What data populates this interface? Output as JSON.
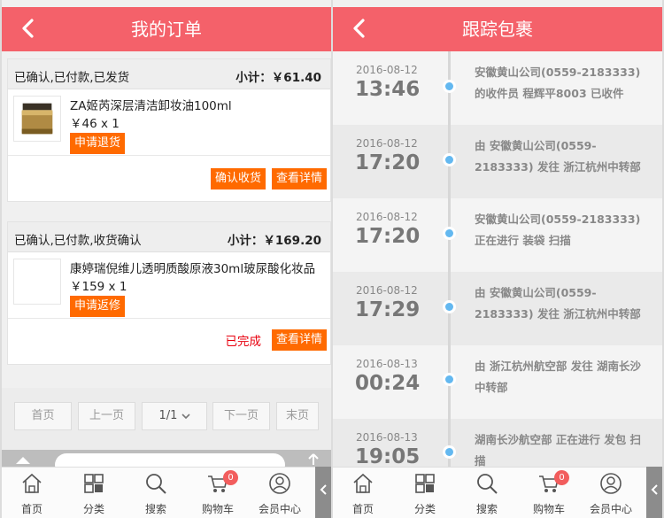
{
  "left": {
    "header": {
      "title": "我的订单"
    },
    "orders": [
      {
        "status": "已确认,已付款,已发货",
        "subtotal": "小计：￥61.40",
        "product_name": "ZA姬芮深层清洁卸妆油100ml",
        "price_qty": "￥46 x 1",
        "item_button": "申请退货",
        "confirm_button": "确认收货",
        "detail_button": "查看详情"
      },
      {
        "status": "已确认,已付款,收货确认",
        "subtotal": "小计：￥169.20",
        "product_name": "康婷瑞倪维儿透明质酸原液30ml玻尿酸化妆品",
        "price_qty": "￥159 x 1",
        "item_button": "申请返修",
        "done_text": "已完成",
        "detail_button": "查看详情"
      }
    ],
    "pager": {
      "first": "首页",
      "prev": "上一页",
      "page": "1/1",
      "next": "下一页",
      "last": "末页"
    },
    "tabbar": {
      "home": "首页",
      "category": "分类",
      "search": "搜索",
      "cart": "购物车",
      "cart_badge": "0",
      "member": "会员中心"
    }
  },
  "right": {
    "header": {
      "title": "跟踪包裹"
    },
    "tracking": [
      {
        "date": "2016-08-12",
        "time": "13:46",
        "desc": "安徽黄山公司(0559-2183333) 的收件员 程辉平8003 已收件"
      },
      {
        "date": "2016-08-12",
        "time": "17:20",
        "desc": "由 安徽黄山公司(0559-2183333) 发往 浙江杭州中转部"
      },
      {
        "date": "2016-08-12",
        "time": "17:20",
        "desc": "安徽黄山公司(0559-2183333) 正在进行 装袋 扫描"
      },
      {
        "date": "2016-08-12",
        "time": "17:29",
        "desc": "由 安徽黄山公司(0559-2183333) 发往 浙江杭州中转部"
      },
      {
        "date": "2016-08-13",
        "time": "00:24",
        "desc": "由 浙江杭州航空部 发往 湖南长沙中转部"
      },
      {
        "date": "2016-08-13",
        "time": "19:05",
        "desc": "湖南长沙航空部 正在进行 发包 扫描"
      }
    ],
    "tabbar": {
      "home": "首页",
      "category": "分类",
      "search": "搜索",
      "cart": "购物车",
      "cart_badge": "0",
      "member": "会员中心"
    }
  },
  "colors": {
    "header": "#f4616a",
    "orange_button": "#ff6a00",
    "done_red": "#e8000e",
    "timeline_dot": "#63b8f0"
  }
}
